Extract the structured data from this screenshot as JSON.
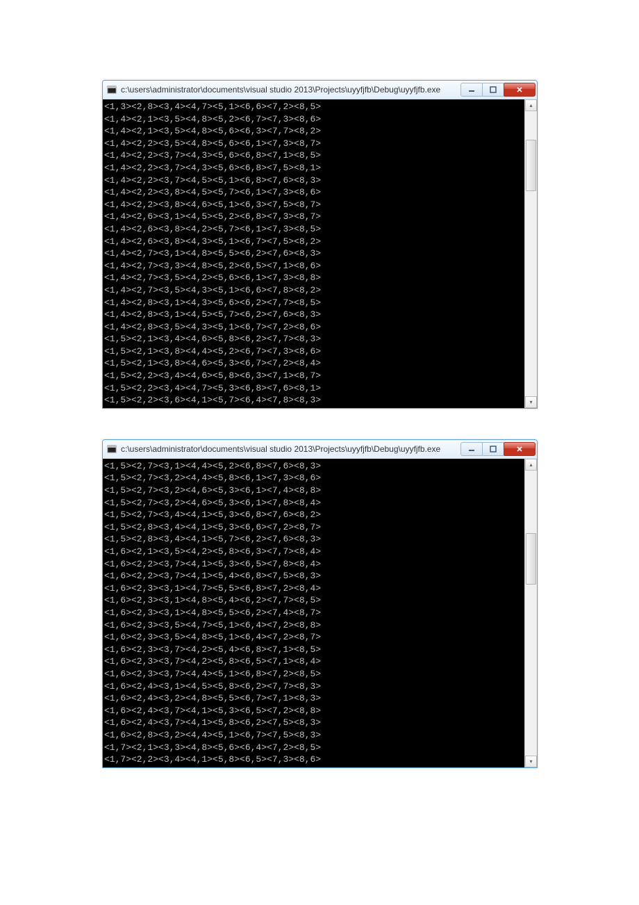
{
  "window_title": "c:\\users\\administrator\\documents\\visual studio 2013\\Projects\\uyyfjfb\\Debug\\uyyfjfb.exe",
  "icons": {
    "app": "console-app-icon",
    "min": "minimize-icon",
    "max": "maximize-icon",
    "close": "close-icon",
    "up": "scroll-up-icon",
    "down": "scroll-down-icon"
  },
  "console1": {
    "thumb_top_pct": 10,
    "thumb_height_pct": 18,
    "lines": [
      "<1,3><2,8><3,4><4,7><5,1><6,6><7,2><8,5>",
      "<1,4><2,1><3,5><4,8><5,2><6,7><7,3><8,6>",
      "<1,4><2,1><3,5><4,8><5,6><6,3><7,7><8,2>",
      "<1,4><2,2><3,5><4,8><5,6><6,1><7,3><8,7>",
      "<1,4><2,2><3,7><4,3><5,6><6,8><7,1><8,5>",
      "<1,4><2,2><3,7><4,3><5,6><6,8><7,5><8,1>",
      "<1,4><2,2><3,7><4,5><5,1><6,8><7,6><8,3>",
      "<1,4><2,2><3,8><4,5><5,7><6,1><7,3><8,6>",
      "<1,4><2,2><3,8><4,6><5,1><6,3><7,5><8,7>",
      "<1,4><2,6><3,1><4,5><5,2><6,8><7,3><8,7>",
      "<1,4><2,6><3,8><4,2><5,7><6,1><7,3><8,5>",
      "<1,4><2,6><3,8><4,3><5,1><6,7><7,5><8,2>",
      "<1,4><2,7><3,1><4,8><5,5><6,2><7,6><8,3>",
      "<1,4><2,7><3,3><4,8><5,2><6,5><7,1><8,6>",
      "<1,4><2,7><3,5><4,2><5,6><6,1><7,3><8,8>",
      "<1,4><2,7><3,5><4,3><5,1><6,6><7,8><8,2>",
      "<1,4><2,8><3,1><4,3><5,6><6,2><7,7><8,5>",
      "<1,4><2,8><3,1><4,5><5,7><6,2><7,6><8,3>",
      "<1,4><2,8><3,5><4,3><5,1><6,7><7,2><8,6>",
      "<1,5><2,1><3,4><4,6><5,8><6,2><7,7><8,3>",
      "<1,5><2,1><3,8><4,4><5,2><6,7><7,3><8,6>",
      "<1,5><2,1><3,8><4,6><5,3><6,7><7,2><8,4>",
      "<1,5><2,2><3,4><4,6><5,8><6,3><7,1><8,7>",
      "<1,5><2,2><3,4><4,7><5,3><6,8><7,6><8,1>",
      "<1,5><2,2><3,6><4,1><5,7><6,4><7,8><8,3>"
    ]
  },
  "console2": {
    "thumb_top_pct": 22,
    "thumb_height_pct": 18,
    "lines": [
      "<1,5><2,7><3,1><4,4><5,2><6,8><7,6><8,3>",
      "<1,5><2,7><3,2><4,4><5,8><6,1><7,3><8,6>",
      "<1,5><2,7><3,2><4,6><5,3><6,1><7,4><8,8>",
      "<1,5><2,7><3,2><4,6><5,3><6,1><7,8><8,4>",
      "<1,5><2,7><3,4><4,1><5,3><6,8><7,6><8,2>",
      "<1,5><2,8><3,4><4,1><5,3><6,6><7,2><8,7>",
      "<1,5><2,8><3,4><4,1><5,7><6,2><7,6><8,3>",
      "<1,6><2,1><3,5><4,2><5,8><6,3><7,7><8,4>",
      "<1,6><2,2><3,7><4,1><5,3><6,5><7,8><8,4>",
      "<1,6><2,2><3,7><4,1><5,4><6,8><7,5><8,3>",
      "<1,6><2,3><3,1><4,7><5,5><6,8><7,2><8,4>",
      "<1,6><2,3><3,1><4,8><5,4><6,2><7,7><8,5>",
      "<1,6><2,3><3,1><4,8><5,5><6,2><7,4><8,7>",
      "<1,6><2,3><3,5><4,7><5,1><6,4><7,2><8,8>",
      "<1,6><2,3><3,5><4,8><5,1><6,4><7,2><8,7>",
      "<1,6><2,3><3,7><4,2><5,4><6,8><7,1><8,5>",
      "<1,6><2,3><3,7><4,2><5,8><6,5><7,1><8,4>",
      "<1,6><2,3><3,7><4,4><5,1><6,8><7,2><8,5>",
      "<1,6><2,4><3,1><4,5><5,8><6,2><7,7><8,3>",
      "<1,6><2,4><3,2><4,8><5,5><6,7><7,1><8,3>",
      "<1,6><2,4><3,7><4,1><5,3><6,5><7,2><8,8>",
      "<1,6><2,4><3,7><4,1><5,8><6,2><7,5><8,3>",
      "<1,6><2,8><3,2><4,4><5,1><6,7><7,5><8,3>",
      "<1,7><2,1><3,3><4,8><5,6><6,4><7,2><8,5>",
      "<1,7><2,2><3,4><4,1><5,8><6,5><7,3><8,6>"
    ]
  }
}
